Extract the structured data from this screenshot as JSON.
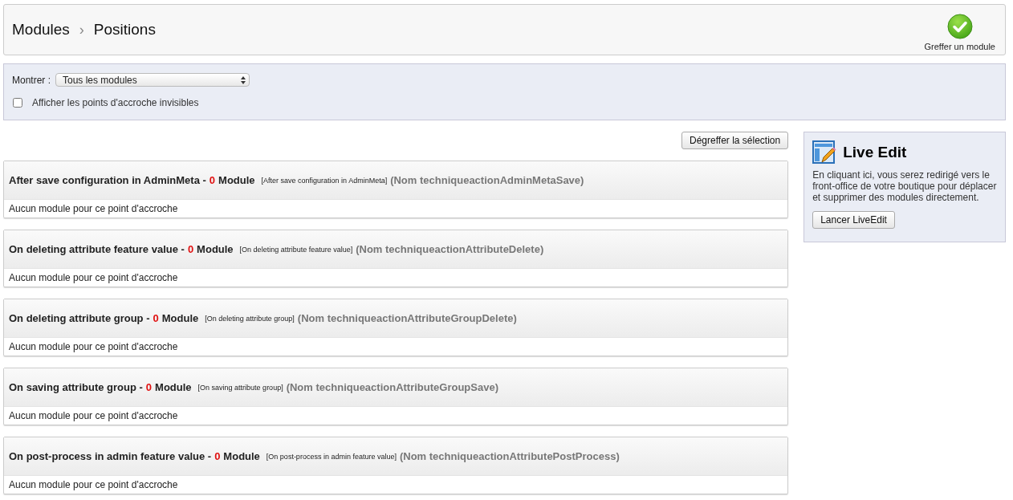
{
  "breadcrumb": {
    "parent": "Modules",
    "separator": "›",
    "current": "Positions"
  },
  "toolbar": {
    "transplant_button": "Greffer un module"
  },
  "filters": {
    "show_label": "Montrer :",
    "show_select": "Tous les modules",
    "invisible_hooks": {
      "label": "Afficher les points d'accroche invisibles",
      "checked": false
    }
  },
  "unhook_button": "Dégreffer la sélection",
  "hooks": [
    {
      "heading": "After save configuration in AdminMeta -",
      "count": "0",
      "count_unit": "Module",
      "description": "[After save configuration in AdminMeta]",
      "technical_name": "(Nom techniqueactionAdminMetaSave)",
      "empty_message": "Aucun module pour ce point d'accroche"
    },
    {
      "heading": "On deleting attribute feature value -",
      "count": "0",
      "count_unit": "Module",
      "description": "[On deleting attribute feature value]",
      "technical_name": "(Nom techniqueactionAttributeDelete)",
      "empty_message": "Aucun module pour ce point d'accroche"
    },
    {
      "heading": "On deleting attribute group -",
      "count": "0",
      "count_unit": "Module",
      "description": "[On deleting attribute group]",
      "technical_name": "(Nom techniqueactionAttributeGroupDelete)",
      "empty_message": "Aucun module pour ce point d'accroche"
    },
    {
      "heading": "On saving attribute group -",
      "count": "0",
      "count_unit": "Module",
      "description": "[On saving attribute group]",
      "technical_name": "(Nom techniqueactionAttributeGroupSave)",
      "empty_message": "Aucun module pour ce point d'accroche"
    },
    {
      "heading": "On post-process in admin feature value -",
      "count": "0",
      "count_unit": "Module",
      "description": "[On post-process in admin feature value]",
      "technical_name": "(Nom techniqueactionAttributePostProcess)",
      "empty_message": "Aucun module pour ce point d'accroche"
    }
  ],
  "live_edit": {
    "title": "Live Edit",
    "text": "En cliquant ici, vous serez redirigé vers le front-office de votre boutique pour déplacer et supprimer des modules directement.",
    "button": "Lancer LiveEdit"
  }
}
